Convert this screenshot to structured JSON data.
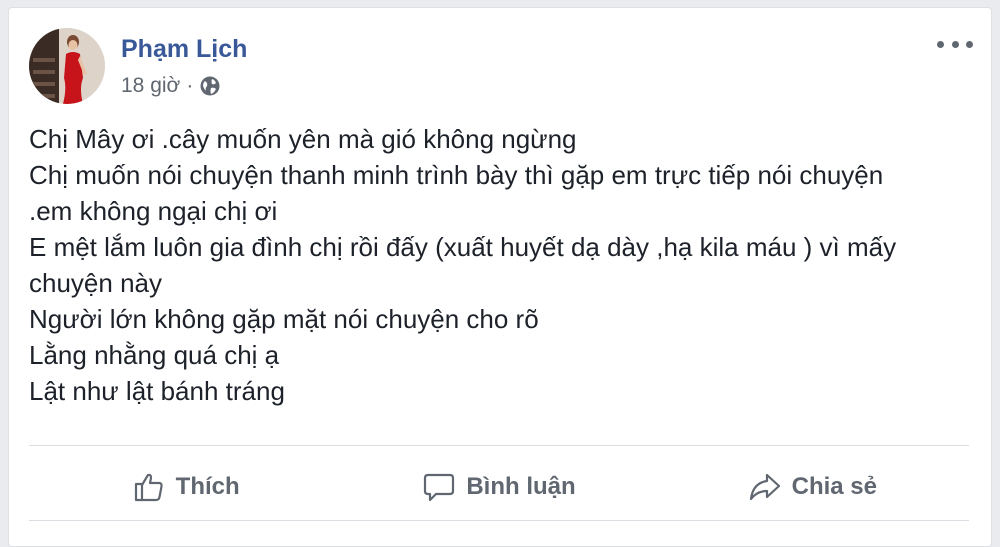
{
  "post": {
    "author": "Phạm Lịch",
    "time": "18 giờ",
    "separator": "·",
    "privacy_icon": "globe-icon",
    "more_icon": "more-options-icon",
    "lines": [
      "Chị Mây ơi .cây muốn yên mà gió không ngừng",
      "Chị muốn nói chuyện thanh minh trình bày thì gặp em trực tiếp nói chuyện",
      ".em không ngại chị ơi",
      "E mệt lắm luôn gia đình chị rồi đấy (xuất huyết dạ dày ,hạ kila máu ) vì mấy",
      "chuyện này",
      "Người lớn không gặp mặt nói chuyện cho rõ",
      "Lằng nhằng quá chị ạ",
      "Lật như lật bánh tráng"
    ]
  },
  "actions": {
    "like_label": "Thích",
    "comment_label": "Bình luận",
    "share_label": "Chia sẻ"
  },
  "colors": {
    "author": "#385898",
    "text": "#1d2129",
    "muted": "#616770",
    "background": "#e9ebee"
  }
}
